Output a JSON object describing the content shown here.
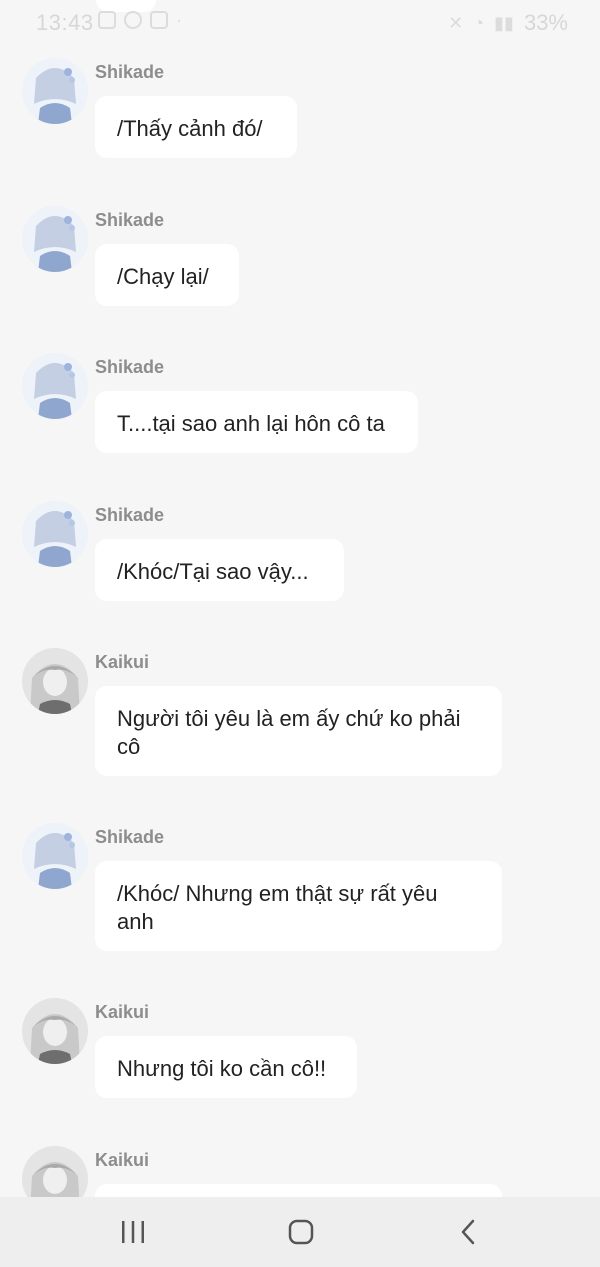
{
  "status_bar": {
    "time": "13:43",
    "battery": "33%"
  },
  "messages": [
    {
      "sender": "Shikade",
      "text": "/Thấy cảnh đó/",
      "avatar": "shikade"
    },
    {
      "sender": "Shikade",
      "text": "/Chạy lại/",
      "avatar": "shikade"
    },
    {
      "sender": "Shikade",
      "text": "T....tại sao anh lại hôn cô ta",
      "avatar": "shikade"
    },
    {
      "sender": "Shikade",
      "text": "/Khóc/Tại sao vậy...",
      "avatar": "shikade"
    },
    {
      "sender": "Kaikui",
      "text": "Người tôi yêu là em ấy chứ ko phải cô",
      "avatar": "kaikui"
    },
    {
      "sender": "Shikade",
      "text": "/Khóc/ Nhưng em thật sự rất yêu anh",
      "avatar": "shikade"
    },
    {
      "sender": "Kaikui",
      "text": "Nhưng tôi ko cần cô!!",
      "avatar": "kaikui"
    },
    {
      "sender": "Kaikui",
      "text": "",
      "avatar": "kaikui"
    }
  ],
  "nav": {
    "recent_icon": "recent-apps-icon",
    "home_icon": "home-icon",
    "back_icon": "back-icon"
  }
}
